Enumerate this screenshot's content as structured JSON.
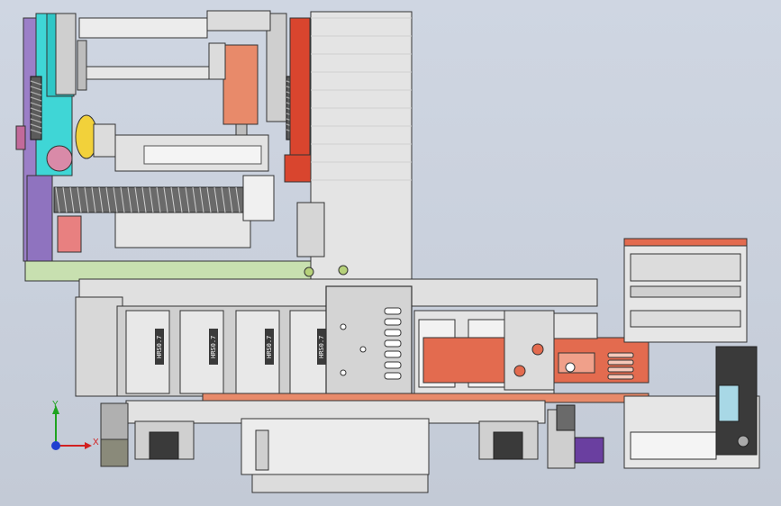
{
  "scene": {
    "type": "cad-assembly-view",
    "colors": {
      "background": "#c9d0dc",
      "frame_gray": "#d9d9d9",
      "rail_purple": "#9b7fc8",
      "plate_cyan": "#3fd6d6",
      "slide_orange": "#e88a6a",
      "bracket_red": "#d9452e",
      "base_green": "#c8e0b0",
      "wheel_yellow": "#f2d13a",
      "cable_dark": "#4a4a4a",
      "block_purple": "#6a3fa0"
    }
  },
  "labels": {
    "chain_tags": [
      "HRS0.7",
      "HRS0.7",
      "HRS0.7",
      "HRS0.7"
    ]
  },
  "triad": {
    "x_label": "X",
    "y_label": "Y",
    "x_color": "#d22020",
    "y_color": "#1fa31f",
    "z_color": "#2040d0"
  }
}
